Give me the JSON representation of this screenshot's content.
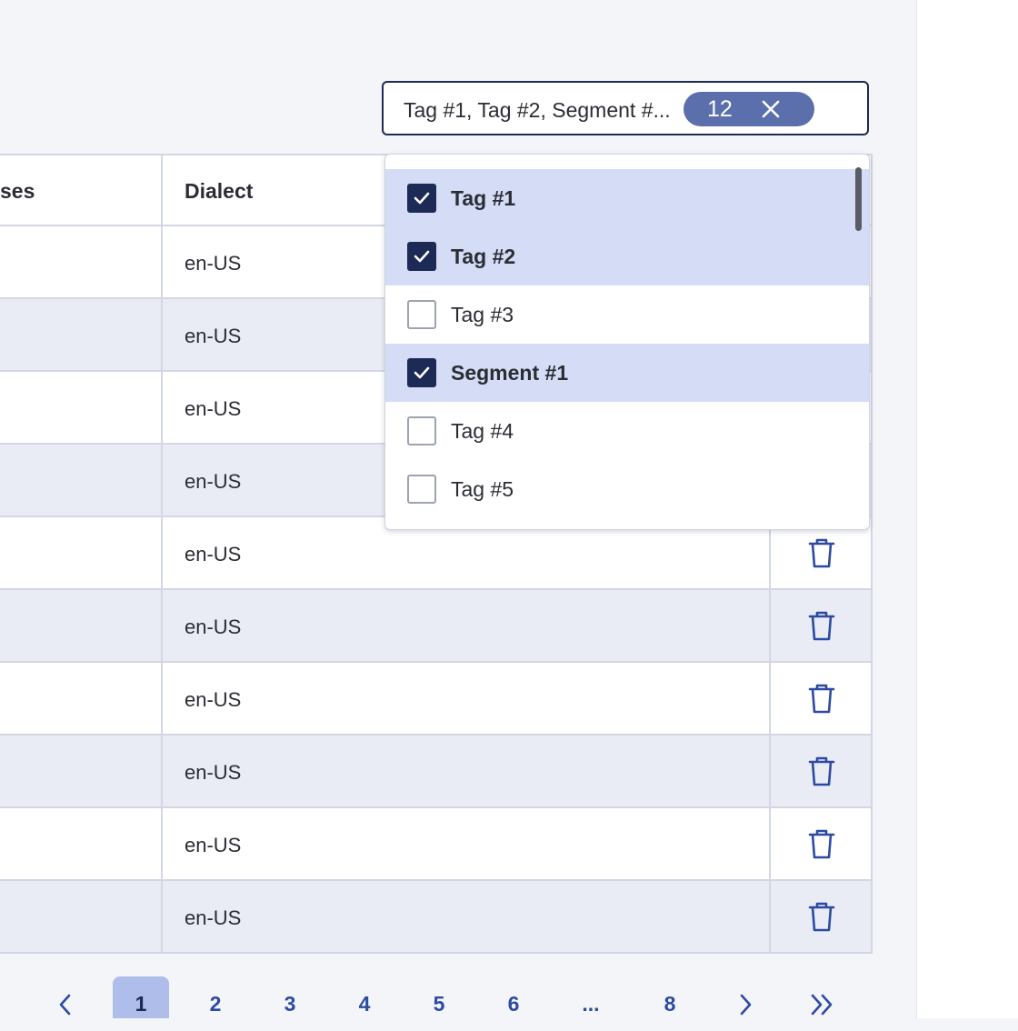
{
  "filter": {
    "selected_text": "Tag #1, Tag #2, Segment #...",
    "count": "12"
  },
  "table": {
    "columns": [
      "ses",
      "Dialect"
    ],
    "rows": [
      {
        "dialect": "en-US"
      },
      {
        "dialect": "en-US"
      },
      {
        "dialect": "en-US"
      },
      {
        "dialect": "en-US"
      },
      {
        "dialect": "en-US"
      },
      {
        "dialect": "en-US"
      },
      {
        "dialect": "en-US"
      },
      {
        "dialect": "en-US"
      },
      {
        "dialect": "en-US"
      },
      {
        "dialect": "en-US"
      }
    ]
  },
  "dropdown": {
    "options": [
      {
        "label": "Tag #1",
        "checked": true
      },
      {
        "label": "Tag #2",
        "checked": true
      },
      {
        "label": "Tag #3",
        "checked": false
      },
      {
        "label": "Segment #1",
        "checked": true
      },
      {
        "label": "Tag #4",
        "checked": false
      },
      {
        "label": "Tag #5",
        "checked": false
      }
    ]
  },
  "pagination": {
    "pages": [
      "1",
      "2",
      "3",
      "4",
      "5",
      "6",
      "...",
      "8"
    ],
    "current": "1"
  },
  "icons": {
    "trash": "trash-icon",
    "clear": "close-icon",
    "check": "checkmark-icon",
    "prev": "chevron-left-icon",
    "next": "chevron-right-icon",
    "last": "double-chevron-right-icon"
  },
  "colors": {
    "accent": "#1c2a55",
    "chip": "#5a6fac",
    "selected_row": "#d4ddf5",
    "link": "#2d4aa3",
    "active_page": "#aebde9"
  }
}
